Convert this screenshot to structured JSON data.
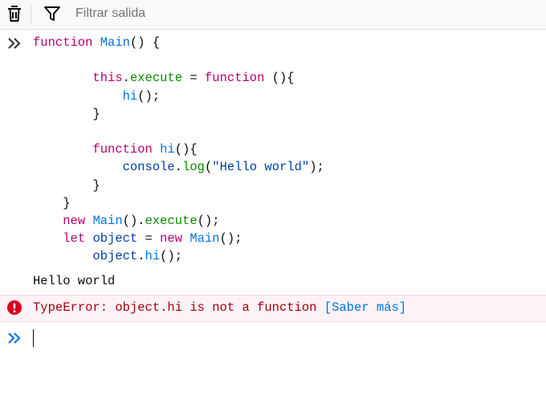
{
  "toolbar": {
    "clear_icon": "trash-icon",
    "filter_icon": "funnel-icon",
    "filter_placeholder": "Filtrar salida",
    "filter_value": ""
  },
  "console": {
    "input_code": {
      "l1_kw": "function",
      "l1_name": "Main",
      "l1_rest": "() {",
      "l3_this": "this",
      "l3_dot": ".",
      "l3_method": "execute",
      "l3_eq": " = ",
      "l3_kw": "function",
      "l3_rest": " (){",
      "l4_call": "hi",
      "l4_rest": "();",
      "l5": "}",
      "l7_kw": "function",
      "l7_name": "hi",
      "l7_rest": "(){",
      "l8_obj": "console",
      "l8_dot": ".",
      "l8_method": "log",
      "l8_open": "(",
      "l8_str": "\"Hello world\"",
      "l8_close": ");",
      "l9": "}",
      "l10": "}",
      "l11_kw": "new",
      "l11_name": "Main",
      "l11_mid": "().",
      "l11_method": "execute",
      "l11_rest": "();",
      "l12_kw": "let",
      "l12_var": "object",
      "l12_eq": " = ",
      "l12_kw2": "new",
      "l12_name": "Main",
      "l12_rest": "();",
      "l13_obj": "object",
      "l13_dot": ".",
      "l13_method": "hi",
      "l13_rest": "();"
    },
    "log_output": "Hello world",
    "error": {
      "message": "TypeError: object.hi is not a function",
      "link": "[Saber más]",
      "icon": "error-circle-icon"
    },
    "prompt_icon": "double-chevron-right-icon",
    "input_value": ""
  },
  "colors": {
    "keyword": "#b6006f",
    "function_name": "#0074e8",
    "identifier": "#003eaa",
    "method": "#058b00",
    "error_text": "#a4000f",
    "error_bg": "#fdf2f5",
    "link": "#0074e8"
  }
}
